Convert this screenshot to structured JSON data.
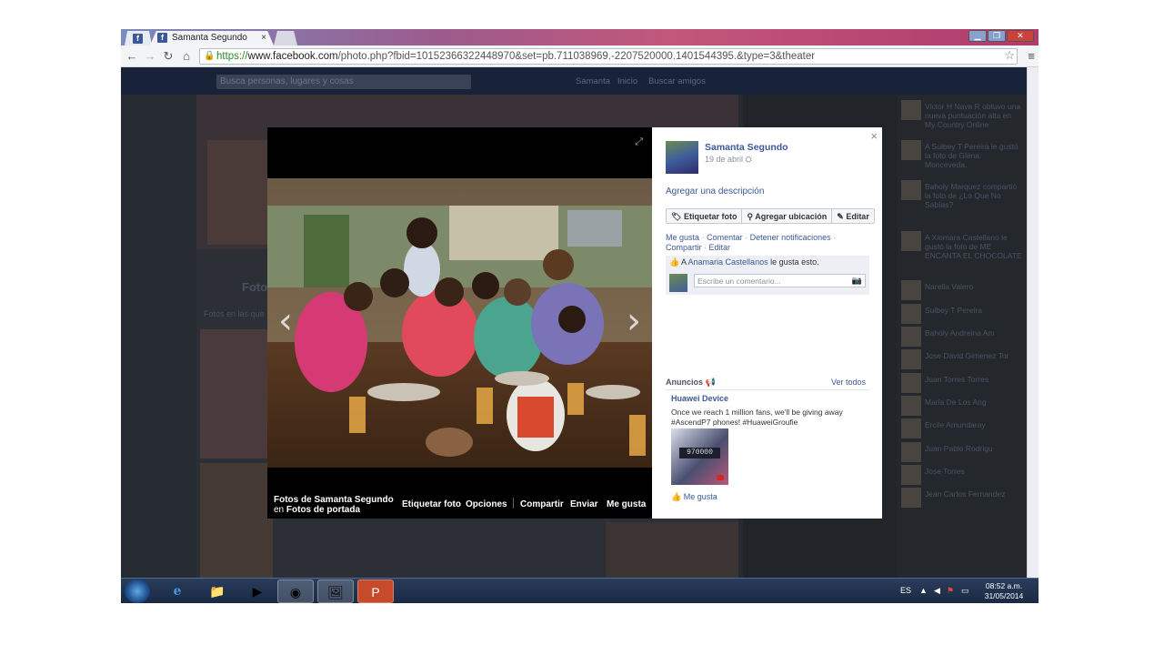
{
  "browser": {
    "tab_title": "Samanta Segundo",
    "tab_close": "×",
    "url_scheme": "https://",
    "url_host": "www.facebook.com",
    "url_path": "/photo.php?fbid=10152366322448970&set=pb.711038969.-2207520000.1401544395.&type=3&theater",
    "window_buttons": [
      "▁",
      "❐",
      "✕"
    ]
  },
  "fb_background": {
    "search_placeholder": "Busca personas, lugares y cosas",
    "nav": [
      "Samanta",
      "Inicio",
      "Buscar amigos"
    ],
    "fotos_label": "Fotos",
    "fotos_sub": "Fotos en las que",
    "sidebar": [
      "Victor H Nava R obtuvo una nueva puntuación alta en My Country Online",
      "A Sulbey T Pereira le gustó la foto de Gléna Monceveda.",
      "Baholy Marquez compartió la foto de ¿Lo Que No Sabías?",
      "A Xiomara Castellano le gustó la foto de ME ENCANTA EL CHOCOLATE",
      "Narella Valero",
      "Sulbey T Pereira",
      "Baholy Andreina Am",
      "Jose David Gimenez Tor",
      "Juan Torres Torres",
      "Maria De Los Ang",
      "Ercile Amundaray",
      "Juan Pablo Rodrigu",
      "Jose Torres",
      "Jean Carlos Fernandez"
    ]
  },
  "photo": {
    "footer_title": "Fotos de Samanta Segundo",
    "footer_in": "en",
    "footer_album": "Fotos de portada",
    "actions": [
      "Etiquetar foto",
      "Opciones",
      "Compartir",
      "Enviar",
      "Me gusta"
    ]
  },
  "panel": {
    "close": "×",
    "name": "Samanta Segundo",
    "date": "19 de abril",
    "add_description": "Agregar una descripción",
    "buttons": [
      "Etiquetar foto",
      "Agregar ubicación",
      "Editar"
    ],
    "links": [
      "Me gusta",
      "Comentar",
      "Detener notificaciones",
      "Compartir",
      "Editar"
    ],
    "likes_prefix": "A",
    "likes_name": "Anamaria Castellanos",
    "likes_suffix": "le gusta esto.",
    "comment_placeholder": "Escribe un comentario...",
    "ads_header": "Anuncios",
    "ads_all": "Ver todos",
    "ad_title": "Huawei Device",
    "ad_body": "Once we reach 1 million fans, we'll be giving away #AscendP7 phones! #HuaweiGroufie",
    "ad_image_text": "970000",
    "ad_like": "Me gusta"
  },
  "taskbar": {
    "lang": "ES",
    "time": "08:52 a.m.",
    "date": "31/05/2014"
  },
  "colors": {
    "fb_blue": "#3b5998",
    "panel_bg": "#ffffff",
    "overlay": "#1a1d24"
  }
}
